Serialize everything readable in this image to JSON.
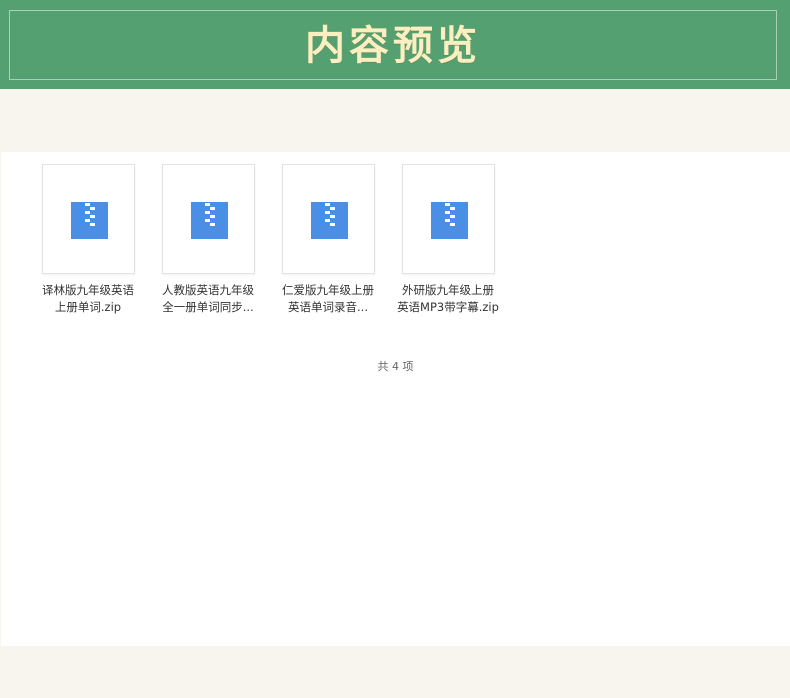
{
  "header": {
    "title": "内容预览"
  },
  "files": [
    {
      "line1": "译林版九年级英语",
      "line2": "上册单词.zip",
      "icon": "zip-file-icon"
    },
    {
      "line1": "人教版英语九年级",
      "line2": "全一册单词同步...",
      "icon": "zip-file-icon"
    },
    {
      "line1": "仁爱版九年级上册",
      "line2": "英语单词录音...",
      "icon": "zip-file-icon"
    },
    {
      "line1": "外研版九年级上册",
      "line2": "英语MP3带字幕.zip",
      "icon": "zip-file-icon"
    }
  ],
  "summary": {
    "count_text": "共 4 项"
  },
  "colors": {
    "header_bg": "#55a070",
    "title": "#fbeec0",
    "zip_blue": "#4a8ee6",
    "page_bg": "#f8f5ee"
  }
}
